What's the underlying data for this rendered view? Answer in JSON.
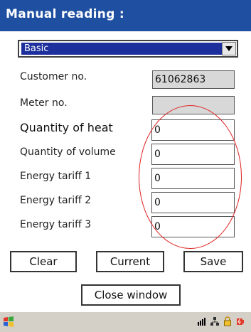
{
  "window": {
    "title": "Manual reading :"
  },
  "dropdown": {
    "selected": "Basic"
  },
  "form": {
    "fields": [
      {
        "label": "Customer no.",
        "value": "61062863"
      },
      {
        "label": "Meter no.",
        "value": ""
      },
      {
        "label": "Quantity of heat",
        "value": "0"
      },
      {
        "label": "Quantity of volume",
        "value": "0"
      },
      {
        "label": "Energy tariff 1",
        "value": "0"
      },
      {
        "label": "Energy tariff 2",
        "value": "0"
      },
      {
        "label": "Energy tariff 3",
        "value": "0"
      }
    ]
  },
  "buttons": {
    "clear": "Clear",
    "current": "Current",
    "save": "Save",
    "close": "Close window"
  },
  "colors": {
    "titlebar": "#1f4fa0",
    "selection": "#1c2f9c",
    "annotation": "#e02020"
  },
  "icons": {
    "start": "windows-flag-icon",
    "tray": [
      "signal-icon",
      "network-icon",
      "lock-icon",
      "battery-icon"
    ]
  }
}
